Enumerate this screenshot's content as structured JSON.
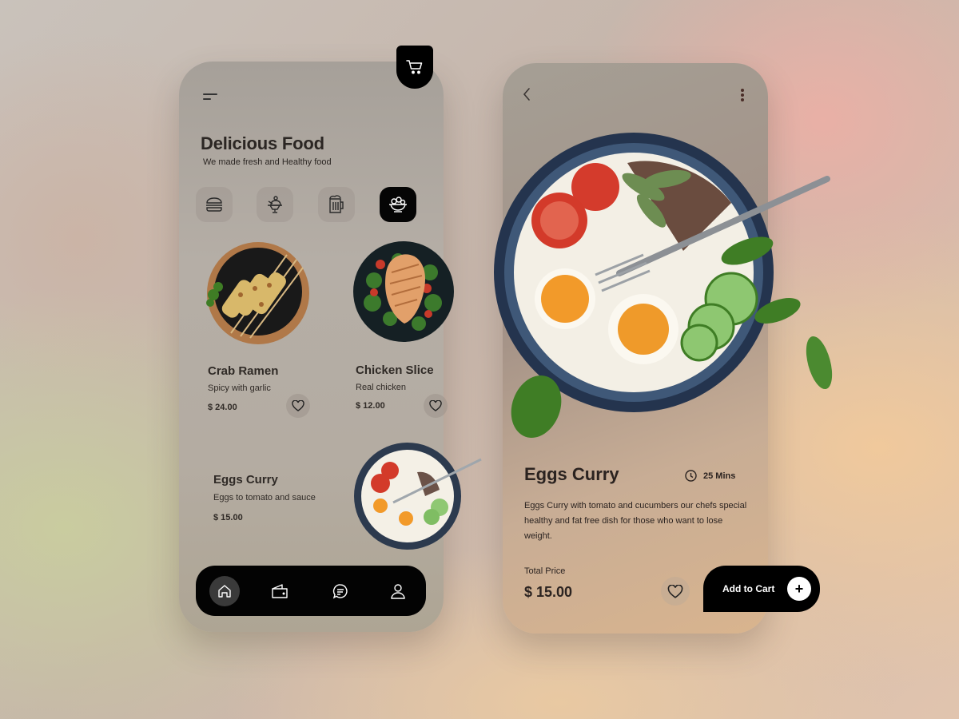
{
  "home_screen": {
    "title": "Delicious Food",
    "subtitle": "We made fresh and Healthy food",
    "header_icons": {
      "menu": "menu-icon",
      "cart": "cart-icon"
    },
    "categories": [
      {
        "icon": "burger-icon",
        "active": false
      },
      {
        "icon": "dessert-icon",
        "active": false
      },
      {
        "icon": "beer-icon",
        "active": false
      },
      {
        "icon": "salad-icon",
        "active": true
      }
    ],
    "dishes": [
      {
        "name": "Crab Ramen",
        "description": "Spicy with garlic",
        "price": "$ 24.00"
      },
      {
        "name": "Chicken Slice",
        "description": "Real chicken",
        "price": "$ 12.00"
      },
      {
        "name": "Eggs Curry",
        "description": "Eggs to tomato and sauce",
        "price": "$ 15.00"
      }
    ],
    "bottom_nav": [
      {
        "icon": "home-icon",
        "active": true
      },
      {
        "icon": "wallet-icon",
        "active": false
      },
      {
        "icon": "chat-icon",
        "active": false
      },
      {
        "icon": "profile-icon",
        "active": false
      }
    ]
  },
  "detail_screen": {
    "header_icons": {
      "back": "chevron-left-icon",
      "more": "more-vertical-icon"
    },
    "name": "Eggs Curry",
    "time": "25 Mins",
    "description": "Eggs Curry with tomato and cucumbers our chefs special healthy and fat free dish for those who want to lose weight.",
    "total_label": "Total Price",
    "total_price": "$ 15.00",
    "add_to_cart_label": "Add to Cart",
    "add_icon": "+"
  },
  "colors": {
    "accent": "#000000",
    "text": "#2b2623"
  }
}
